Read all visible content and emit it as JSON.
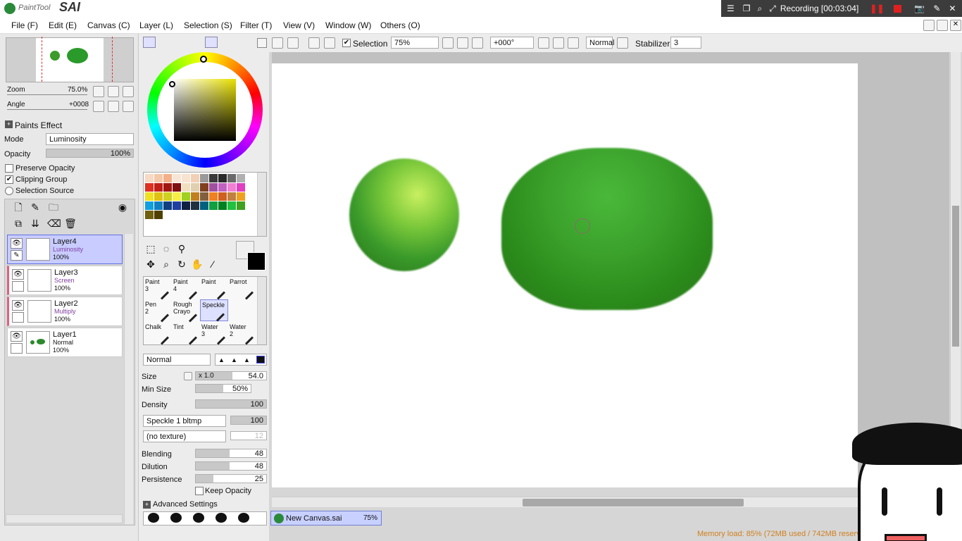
{
  "app": {
    "logo_small": "PaintTool",
    "logo_big": "SAI"
  },
  "recording": {
    "label": "Recording [00:03:04]"
  },
  "menu": [
    {
      "label": "File (F)"
    },
    {
      "label": "Edit (E)"
    },
    {
      "label": "Canvas (C)"
    },
    {
      "label": "Layer (L)"
    },
    {
      "label": "Selection (S)"
    },
    {
      "label": "Filter (T)"
    },
    {
      "label": "View (V)"
    },
    {
      "label": "Window (W)"
    },
    {
      "label": "Others (O)"
    }
  ],
  "navigator": {
    "zoom_label": "Zoom",
    "zoom_value": "75.0%",
    "angle_label": "Angle",
    "angle_value": "+0008"
  },
  "paints_effect": {
    "title": "Paints Effect",
    "mode_label": "Mode",
    "mode_value": "Luminosity",
    "opacity_label": "Opacity",
    "opacity_value": "100%",
    "opacity_level": 1.0,
    "preserve_opacity": "Preserve Opacity",
    "clipping_group": "Clipping Group",
    "selection_source": "Selection Source"
  },
  "layers": [
    {
      "name": "Layer4",
      "mode": "Luminosity",
      "opacity": "100%",
      "selected": true
    },
    {
      "name": "Layer3",
      "mode": "Screen",
      "opacity": "100%",
      "selected": false
    },
    {
      "name": "Layer2",
      "mode": "Multiply",
      "opacity": "100%",
      "selected": false
    },
    {
      "name": "Layer1",
      "mode": "Normal",
      "opacity": "100%",
      "selected": false
    }
  ],
  "palette_colors": [
    "#f7d9c4",
    "#f3c9a9",
    "#f4b088",
    "#f9e5d5",
    "#f6e3d0",
    "#f2d0b5",
    "#9a9a9a",
    "#3a3a3a",
    "#2a2a2a",
    "#6a6a6a",
    "#b0b0b0",
    "#e03020",
    "#c02018",
    "#a01810",
    "#801010",
    "#f0e0c0",
    "#e0d0b0",
    "#804020",
    "#a050a0",
    "#c060c0",
    "#f080d0",
    "#e040c0",
    "#f0e020",
    "#e0c010",
    "#d0d020",
    "#f8f040",
    "#a0d020",
    "#c08020",
    "#806040",
    "#f08020",
    "#d06020",
    "#c08040",
    "#f0a020",
    "#10a0e0",
    "#1080c0",
    "#104080",
    "#2040a0",
    "#102040",
    "#203040",
    "#006080",
    "#10a040",
    "#008020",
    "#20c040",
    "#40a020",
    "#706010",
    "#504000"
  ],
  "brushes": [
    {
      "line1": "Paint",
      "line2": "3"
    },
    {
      "line1": "Paint",
      "line2": "4"
    },
    {
      "line1": "Paint",
      "line2": ""
    },
    {
      "line1": "Parrot",
      "line2": ""
    },
    {
      "line1": "Pen",
      "line2": "2"
    },
    {
      "line1": "Rough",
      "line2": "Crayo"
    },
    {
      "line1": "Speckle",
      "line2": ""
    },
    {
      "line1": "",
      "line2": ""
    },
    {
      "line1": "Chalk",
      "line2": ""
    },
    {
      "line1": "Tint",
      "line2": ""
    },
    {
      "line1": "Water",
      "line2": "3"
    },
    {
      "line1": "Water",
      "line2": "2"
    }
  ],
  "brush_settings": {
    "blend_mode": "Normal",
    "size_label": "Size",
    "size_mult": "x 1.0",
    "size_value": "54.0",
    "min_size_label": "Min Size",
    "min_size_value": "50%",
    "density_label": "Density",
    "density_value": "100",
    "shape": "Speckle 1 bltmp",
    "shape_value": "100",
    "texture": "(no texture)",
    "texture_value": "12",
    "blending_label": "Blending",
    "blending_value": "48",
    "dilution_label": "Dilution",
    "dilution_value": "48",
    "persistence_label": "Persistence",
    "persistence_value": "25",
    "keep_opacity": "Keep Opacity",
    "advanced": "Advanced Settings"
  },
  "toolbar": {
    "selection_label": "Selection",
    "zoom_value": "75%",
    "angle_value": "+000°",
    "blend_value": "Normal",
    "stabilizer_label": "Stabilizer",
    "stabilizer_value": "3"
  },
  "document_tab": {
    "name": "New Canvas.sai",
    "zoom": "75%"
  },
  "status": {
    "memory": "Memory load: 85% (72MB used / 742MB reserv"
  },
  "colors": {
    "accent": "#c8d0ff",
    "memory_text": "#d08020",
    "selected_layer": "#c8ccff"
  }
}
